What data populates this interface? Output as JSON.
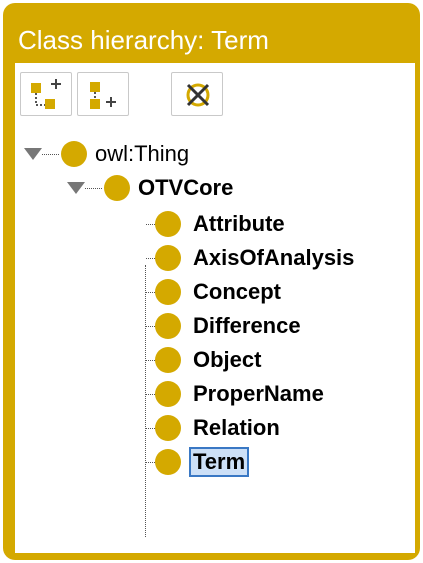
{
  "panel": {
    "title": "Class hierarchy: Term",
    "accent_color": "#d4a900"
  },
  "toolbar": {
    "buttons": [
      {
        "name": "add-subclass",
        "icon": "add-subclass-icon"
      },
      {
        "name": "add-sibling",
        "icon": "add-sibling-class-icon"
      },
      {
        "name": "delete-class",
        "icon": "delete-class-icon"
      }
    ]
  },
  "tree": {
    "root": {
      "label": "owl:Thing",
      "expanded": true
    },
    "child": {
      "label": "OTVCore",
      "expanded": true
    },
    "leaves": [
      {
        "label": "Attribute"
      },
      {
        "label": "AxisOfAnalysis"
      },
      {
        "label": "Concept"
      },
      {
        "label": "Difference"
      },
      {
        "label": "Object"
      },
      {
        "label": "ProperName"
      },
      {
        "label": "Relation"
      },
      {
        "label": "Term",
        "selected": true
      }
    ]
  }
}
